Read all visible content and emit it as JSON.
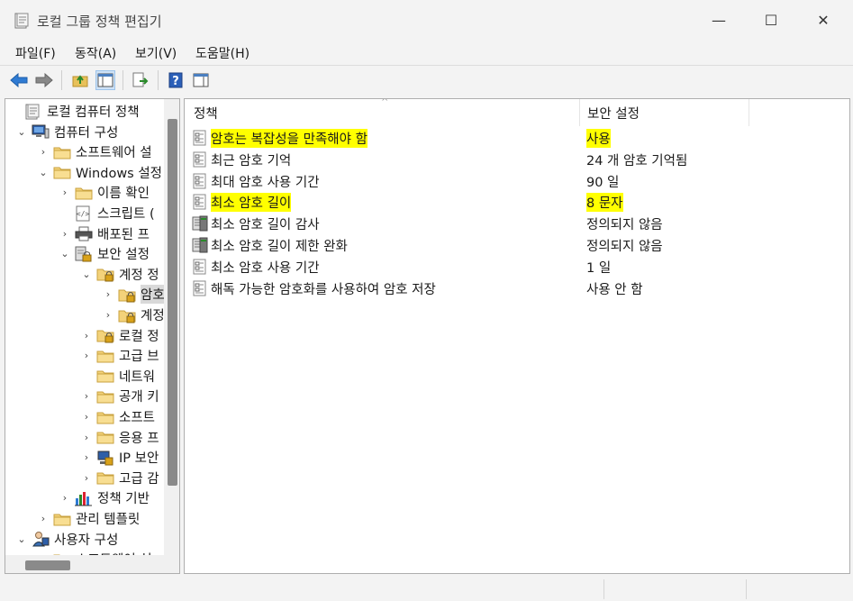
{
  "window": {
    "title": "로컬 그룹 정책 편집기",
    "minimize": "—",
    "maximize": "☐",
    "close": "✕"
  },
  "menu": [
    "파일(F)",
    "동작(A)",
    "보기(V)",
    "도움말(H)"
  ],
  "toolbar": [
    "back-icon",
    "forward-icon",
    "up-folder-icon",
    "show-hide-tree-icon",
    "export-list-icon",
    "help-icon",
    "show-action-pane-icon"
  ],
  "tree": [
    {
      "label": "로컬 컴퓨터 정책",
      "icon": "policy-doc-icon",
      "chevron": ""
    },
    {
      "label": "컴퓨터 구성",
      "icon": "computer-icon",
      "chevron": "v"
    },
    {
      "label": "소프트웨어 설",
      "icon": "folder-icon",
      "chevron": ">"
    },
    {
      "label": "Windows 설정",
      "icon": "folder-icon",
      "chevron": "v"
    },
    {
      "label": "이름 확인",
      "icon": "folder-icon",
      "chevron": ">"
    },
    {
      "label": "스크립트 (",
      "icon": "script-icon",
      "chevron": ""
    },
    {
      "label": "배포된 프",
      "icon": "printer-icon",
      "chevron": ">"
    },
    {
      "label": "보안 설정",
      "icon": "security-icon",
      "chevron": "v"
    },
    {
      "label": "계정 정",
      "icon": "lock-folder-icon",
      "chevron": "v"
    },
    {
      "label": "암호",
      "icon": "lock-folder-icon",
      "chevron": ">"
    },
    {
      "label": "계정",
      "icon": "lock-folder-icon",
      "chevron": ">"
    },
    {
      "label": "로컬 정",
      "icon": "lock-folder-icon",
      "chevron": ">"
    },
    {
      "label": "고급 브",
      "icon": "folder-icon",
      "chevron": ">"
    },
    {
      "label": "네트워",
      "icon": "folder-icon",
      "chevron": ""
    },
    {
      "label": "공개 키",
      "icon": "folder-icon",
      "chevron": ">"
    },
    {
      "label": "소프트",
      "icon": "folder-icon",
      "chevron": ">"
    },
    {
      "label": "응용 프",
      "icon": "folder-icon",
      "chevron": ">"
    },
    {
      "label": "IP 보안",
      "icon": "ip-security-icon",
      "chevron": ">"
    },
    {
      "label": "고급 감",
      "icon": "folder-icon",
      "chevron": ">"
    },
    {
      "label": "정책 기반",
      "icon": "chart-icon",
      "chevron": ">"
    },
    {
      "label": "관리 템플릿",
      "icon": "folder-icon",
      "chevron": ">"
    },
    {
      "label": "사용자 구성",
      "icon": "user-icon",
      "chevron": "v"
    },
    {
      "label": "소프트웨어 설",
      "icon": "folder-icon",
      "chevron": ""
    }
  ],
  "list": {
    "columns": [
      "정책",
      "보안 설정"
    ],
    "rows": [
      {
        "name": "암호는 복잡성을 만족해야 함",
        "value": "사용",
        "highlight": true,
        "icon": "policy-item-icon"
      },
      {
        "name": "최근 암호 기억",
        "value": "24 개 암호 기억됨",
        "highlight": false,
        "icon": "policy-item-icon"
      },
      {
        "name": "최대 암호 사용 기간",
        "value": "90 일",
        "highlight": false,
        "icon": "policy-item-icon"
      },
      {
        "name": "최소 암호 길이",
        "value": "8 문자",
        "highlight": true,
        "icon": "policy-item-icon"
      },
      {
        "name": "최소 암호 길이 감사",
        "value": "정의되지 않음",
        "highlight": false,
        "icon": "policy-audit-icon"
      },
      {
        "name": "최소 암호 길이 제한 완화",
        "value": "정의되지 않음",
        "highlight": false,
        "icon": "policy-audit-icon"
      },
      {
        "name": "최소 암호 사용 기간",
        "value": "1 일",
        "highlight": false,
        "icon": "policy-item-icon"
      },
      {
        "name": "해독 가능한 암호화를 사용하여 암호 저장",
        "value": "사용 안 함",
        "highlight": false,
        "icon": "policy-item-icon"
      }
    ]
  }
}
